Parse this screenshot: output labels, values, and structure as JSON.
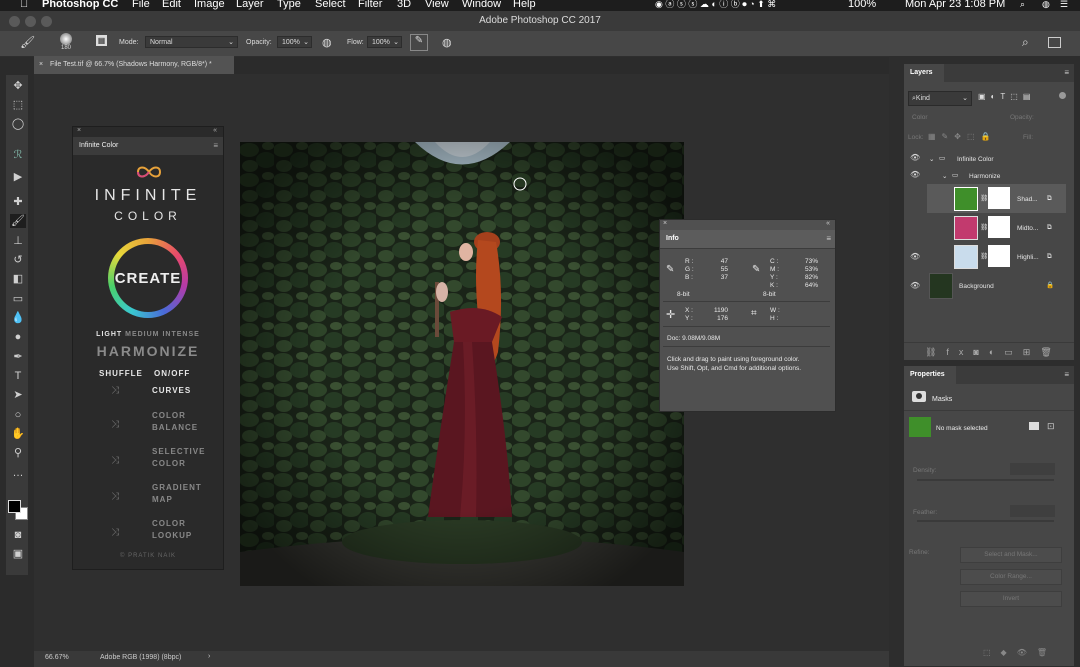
{
  "menubar": {
    "app_name": "Photoshop CC",
    "items": [
      "File",
      "Edit",
      "Image",
      "Layer",
      "Type",
      "Select",
      "Filter",
      "3D",
      "View",
      "Window",
      "Help"
    ],
    "battery": "100%",
    "clock": "Mon Apr 23  1:08 PM"
  },
  "window": {
    "title": "Adobe Photoshop CC 2017"
  },
  "options": {
    "brush_size": "180",
    "mode_label": "Mode:",
    "mode_value": "Normal",
    "opacity_label": "Opacity:",
    "opacity_value": "100%",
    "flow_label": "Flow:",
    "flow_value": "100%"
  },
  "document": {
    "tab_title": "File Test.tif @ 66.7% (Shadows Harmony, RGB/8*) *"
  },
  "status": {
    "zoom": "66.67%",
    "profile": "Adobe RGB (1998) (8bpc)"
  },
  "infinite_color": {
    "panel_title": "Infinite Color",
    "logo_line1": "INFINITE",
    "logo_line2": "COLOR",
    "create_label": "CREATE",
    "intensity_light": "LIGHT",
    "intensity_medium": "MEDIUM",
    "intensity_intense": "INTENSE",
    "harmonize_label": "HARMONIZE",
    "shuffle_label": "SHUFFLE",
    "onoff_label": "ON/OFF",
    "rows": [
      {
        "l1": "CURVES",
        "l2": ""
      },
      {
        "l1": "COLOR",
        "l2": "BALANCE"
      },
      {
        "l1": "SELECTIVE",
        "l2": "COLOR"
      },
      {
        "l1": "GRADIENT",
        "l2": "MAP"
      },
      {
        "l1": "COLOR",
        "l2": "LOOKUP"
      }
    ],
    "credit": "© PRATIK NAIK"
  },
  "info": {
    "panel_title": "Info",
    "r_label": "R :",
    "r_value": "47",
    "g_label": "G :",
    "g_value": "55",
    "b_label": "B :",
    "b_value": "37",
    "bit_left": "8-bit",
    "c_label": "C :",
    "c_value": "73%",
    "m_label": "M :",
    "m_value": "53%",
    "y_label": "Y :",
    "y_value": "82%",
    "k_label": "K :",
    "k_value": "64%",
    "bit_right": "8-bit",
    "x_label": "X :",
    "x_value": "1190",
    "yy_label": "Y :",
    "yy_value": "176",
    "w_label": "W :",
    "h_label": "H :",
    "doc": "Doc: 9.08M/9.08M",
    "hint1": "Click and drag to paint using foreground color.",
    "hint2": "Use Shift, Opt, and Cmd for additional options."
  },
  "layers": {
    "panel_title": "Layers",
    "filter_kind": "Kind",
    "blend_placeholder": "Color",
    "opacity_label": "Opacity:",
    "lock_label": "Lock:",
    "fill_label": "Fill:",
    "items": [
      {
        "name": "Infinite Color"
      },
      {
        "name": "Harmonize"
      },
      {
        "name": "Shad..."
      },
      {
        "name": "Midto..."
      },
      {
        "name": "Highli..."
      },
      {
        "name": "Background"
      }
    ]
  },
  "properties": {
    "panel_title": "Properties",
    "section": "Masks",
    "mask_status": "No mask selected",
    "density_label": "Density:",
    "feather_label": "Feather:",
    "refine_label": "Refine:",
    "select_mask_btn": "Select and Mask...",
    "color_range_btn": "Color Range...",
    "invert_btn": "Invert"
  },
  "colors": {
    "accent_green": "#3f8f2a",
    "accent_pink": "#c23a6e",
    "accent_lightblue": "#c9dcec"
  }
}
